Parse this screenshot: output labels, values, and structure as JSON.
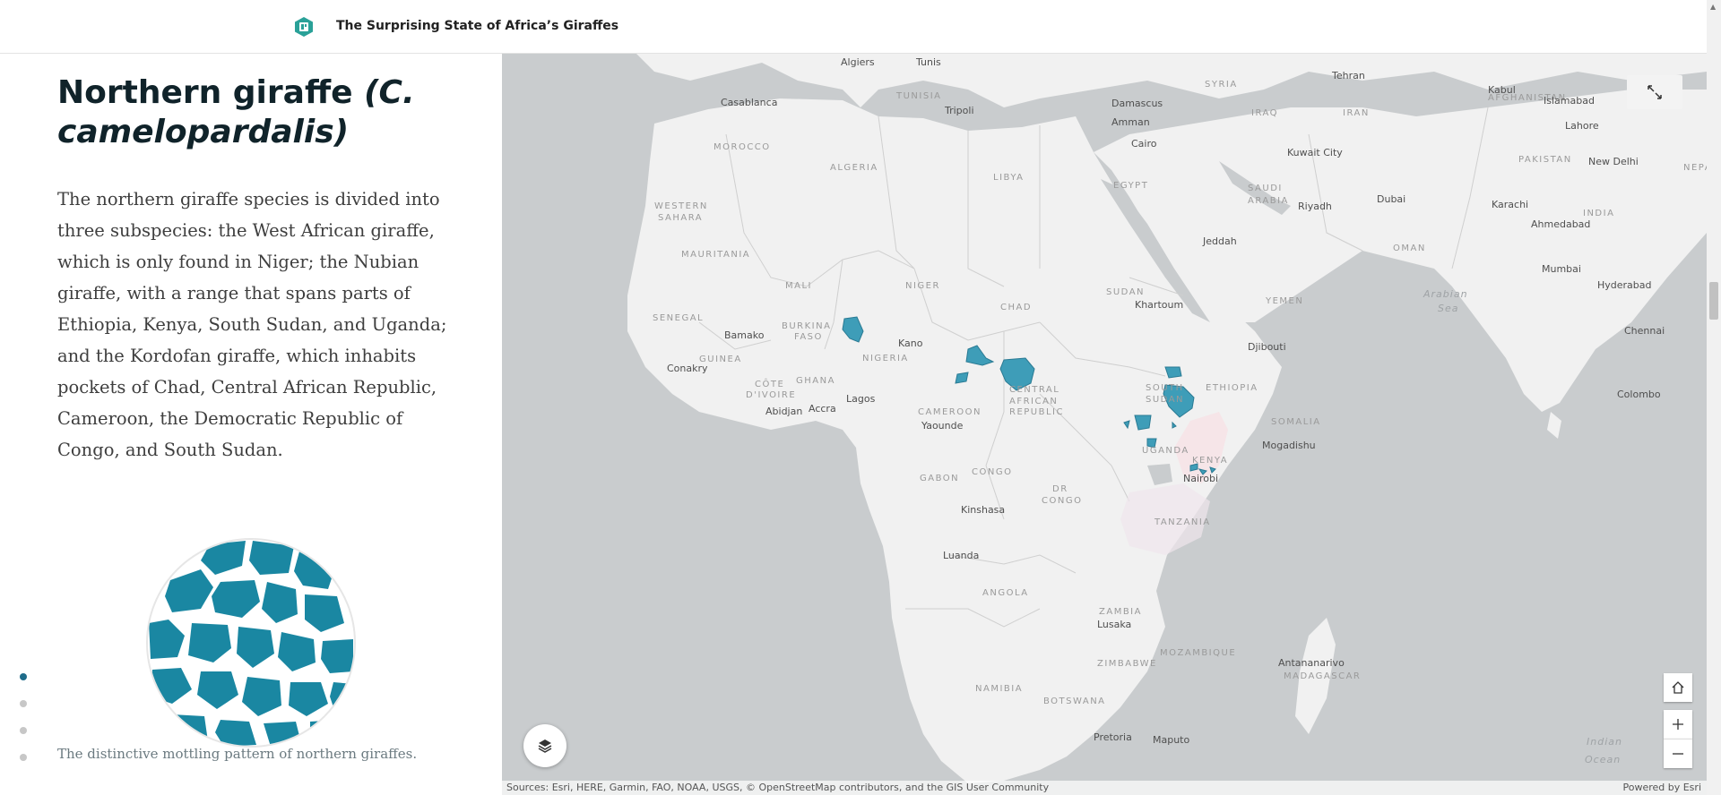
{
  "header": {
    "title": "The Surprising State of Africa’s Giraffes",
    "logo_icon": "storymap-logo-icon"
  },
  "section": {
    "heading": "Northern giraffe",
    "heading_sci": "(C. camelopardalis)",
    "body": "The northern giraffe species is divided into three subspecies: the West African giraffe, which is only found in Niger; the Nubian giraffe, with a range that spans parts of Ethiopia, Kenya, South Sudan, and Uganda; and the Kordofan giraffe, which inhabits pockets of Chad, Central African Republic, Cameroon, the Democratic Republic of Congo, and South Sudan.",
    "caption": "The distinctive mottling pattern of northern giraffes."
  },
  "nav_dots": {
    "count": 4,
    "active": 1
  },
  "map": {
    "cities": [
      {
        "id": "algiers",
        "label": "Algiers"
      },
      {
        "id": "tunis",
        "label": "Tunis"
      },
      {
        "id": "tehran",
        "label": "Tehran"
      },
      {
        "id": "kabul",
        "label": "Kabul"
      },
      {
        "id": "islamabad",
        "label": "Islamabad"
      },
      {
        "id": "casablanca",
        "label": "Casablanca"
      },
      {
        "id": "tripoli",
        "label": "Tripoli"
      },
      {
        "id": "damascus",
        "label": "Damascus"
      },
      {
        "id": "amman",
        "label": "Amman"
      },
      {
        "id": "lahore",
        "label": "Lahore"
      },
      {
        "id": "cairo",
        "label": "Cairo"
      },
      {
        "id": "kuwait",
        "label": "Kuwait City"
      },
      {
        "id": "newdelhi",
        "label": "New Delhi"
      },
      {
        "id": "dubai",
        "label": "Dubai"
      },
      {
        "id": "karachi",
        "label": "Karachi"
      },
      {
        "id": "riyadh",
        "label": "Riyadh"
      },
      {
        "id": "ahmedabad",
        "label": "Ahmedabad"
      },
      {
        "id": "jeddah",
        "label": "Jeddah"
      },
      {
        "id": "mumbai",
        "label": "Mumbai"
      },
      {
        "id": "hyderabad",
        "label": "Hyderabad"
      },
      {
        "id": "khartoum",
        "label": "Khartoum"
      },
      {
        "id": "bamako",
        "label": "Bamako"
      },
      {
        "id": "kano",
        "label": "Kano"
      },
      {
        "id": "chennai",
        "label": "Chennai"
      },
      {
        "id": "djibouti",
        "label": "Djibouti"
      },
      {
        "id": "conakry",
        "label": "Conakry"
      },
      {
        "id": "lagos",
        "label": "Lagos"
      },
      {
        "id": "colombo",
        "label": "Colombo"
      },
      {
        "id": "abidjan",
        "label": "Abidjan"
      },
      {
        "id": "accra",
        "label": "Accra"
      },
      {
        "id": "yaounde",
        "label": "Yaounde"
      },
      {
        "id": "mogadishu",
        "label": "Mogadishu"
      },
      {
        "id": "nairobi",
        "label": "Nairobi"
      },
      {
        "id": "kinshasa",
        "label": "Kinshasa"
      },
      {
        "id": "luanda",
        "label": "Luanda"
      },
      {
        "id": "lusaka",
        "label": "Lusaka"
      },
      {
        "id": "antananarivo",
        "label": "Antananarivo"
      },
      {
        "id": "pretoria",
        "label": "Pretoria"
      },
      {
        "id": "maputo",
        "label": "Maputo"
      }
    ],
    "countries": [
      {
        "id": "tunisia",
        "label": "TUNISIA"
      },
      {
        "id": "syria",
        "label": "SYRIA"
      },
      {
        "id": "afghanistan",
        "label": "AFGHANISTAN"
      },
      {
        "id": "iraq",
        "label": "IRAQ"
      },
      {
        "id": "iran",
        "label": "IRAN"
      },
      {
        "id": "morocco",
        "label": "MOROCCO"
      },
      {
        "id": "pakistan",
        "label": "PAKISTAN"
      },
      {
        "id": "nepal",
        "label": "NEPAL"
      },
      {
        "id": "algeria",
        "label": "ALGERIA"
      },
      {
        "id": "libya",
        "label": "LIBYA"
      },
      {
        "id": "egypt",
        "label": "EGYPT"
      },
      {
        "id": "saudi1",
        "label": "SAUDI"
      },
      {
        "id": "saudi2",
        "label": "ARABIA"
      },
      {
        "id": "westernsahara1",
        "label": "WESTERN"
      },
      {
        "id": "westernsahara2",
        "label": "SAHARA"
      },
      {
        "id": "india",
        "label": "INDIA"
      },
      {
        "id": "oman",
        "label": "OMAN"
      },
      {
        "id": "mauritania",
        "label": "MAURITANIA"
      },
      {
        "id": "mali",
        "label": "MALI"
      },
      {
        "id": "niger",
        "label": "NIGER"
      },
      {
        "id": "chad",
        "label": "CHAD"
      },
      {
        "id": "sudan",
        "label": "SUDAN"
      },
      {
        "id": "yemen",
        "label": "YEMEN"
      },
      {
        "id": "senegal",
        "label": "SENEGAL"
      },
      {
        "id": "burkina1",
        "label": "BURKINA"
      },
      {
        "id": "burkina2",
        "label": "FASO"
      },
      {
        "id": "guinea",
        "label": "GUINEA"
      },
      {
        "id": "nigeria",
        "label": "NIGERIA"
      },
      {
        "id": "southsudan1",
        "label": "SOUTH"
      },
      {
        "id": "southsudan2",
        "label": "SUDAN"
      },
      {
        "id": "ethiopia",
        "label": "ETHIOPIA"
      },
      {
        "id": "cote1",
        "label": "CÔTE"
      },
      {
        "id": "cote2",
        "label": "D'IVOIRE"
      },
      {
        "id": "ghana",
        "label": "GHANA"
      },
      {
        "id": "car1",
        "label": "CENTRAL"
      },
      {
        "id": "car2",
        "label": "AFRICAN"
      },
      {
        "id": "car3",
        "label": "REPUBLIC"
      },
      {
        "id": "somalia",
        "label": "SOMALIA"
      },
      {
        "id": "cameroon",
        "label": "CAMEROON"
      },
      {
        "id": "uganda",
        "label": "UGANDA"
      },
      {
        "id": "kenya",
        "label": "KENYA"
      },
      {
        "id": "gabon",
        "label": "GABON"
      },
      {
        "id": "congo",
        "label": "CONGO"
      },
      {
        "id": "dr1",
        "label": "DR"
      },
      {
        "id": "dr2",
        "label": "CONGO"
      },
      {
        "id": "tanzania",
        "label": "TANZANIA"
      },
      {
        "id": "angola",
        "label": "ANGOLA"
      },
      {
        "id": "zambia",
        "label": "ZAMBIA"
      },
      {
        "id": "mozambique",
        "label": "MOZAMBIQUE"
      },
      {
        "id": "zimbabwe",
        "label": "ZIMBABWE"
      },
      {
        "id": "madagascar",
        "label": "MADAGASCAR"
      },
      {
        "id": "namibia",
        "label": "NAMIBIA"
      },
      {
        "id": "botswana",
        "label": "BOTSWANA"
      }
    ],
    "seas": [
      {
        "id": "arabian1",
        "label": "Arabian"
      },
      {
        "id": "arabian2",
        "label": "Sea"
      },
      {
        "id": "indian1",
        "label": "Indian"
      },
      {
        "id": "indian2",
        "label": "Ocean"
      }
    ],
    "attribution": "Sources: Esri, HERE, Garmin, FAO, NOAA, USGS, © OpenStreetMap contributors, and the GIS User Community",
    "powered_by": "Powered by Esri",
    "colors": {
      "water": "#c9ccce",
      "land": "#f1f1f1",
      "range": "#3e9db8",
      "range_stroke": "#2a7a93",
      "highlight": "#f7e3e6"
    }
  }
}
